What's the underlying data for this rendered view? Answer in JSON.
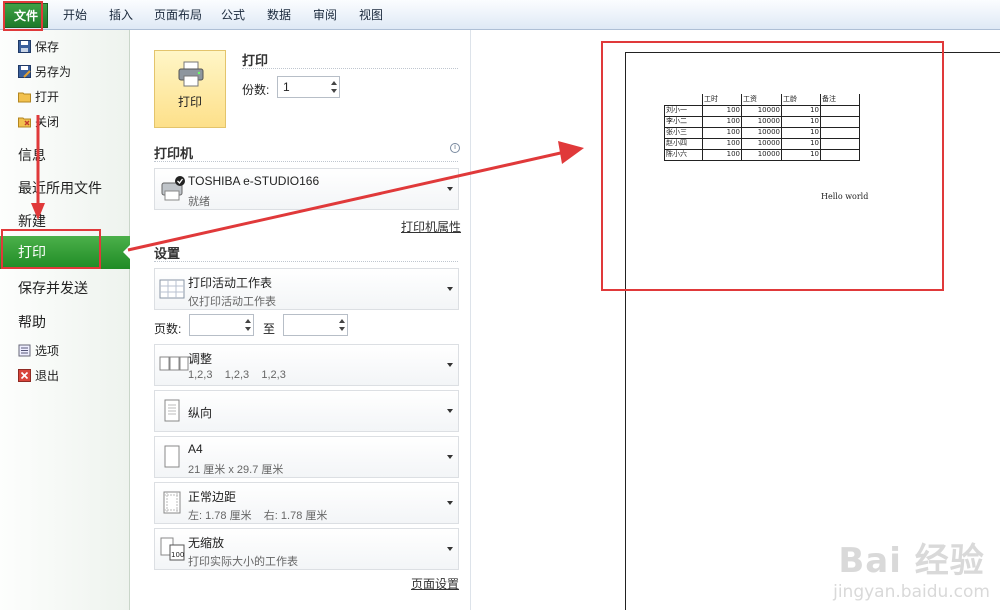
{
  "ribbon": {
    "tabs": [
      "文件",
      "开始",
      "插入",
      "页面布局",
      "公式",
      "数据",
      "审阅",
      "视图"
    ]
  },
  "nav": {
    "save": "保存",
    "save_as": "另存为",
    "open": "打开",
    "close": "关闭",
    "info": "信息",
    "recent": "最近所用文件",
    "new": "新建",
    "print": "打印",
    "save_send": "保存并发送",
    "help": "帮助",
    "options": "选项",
    "exit": "退出"
  },
  "print_panel": {
    "title": "打印",
    "button_label": "打印",
    "copies_label": "份数:",
    "copies_value": "1",
    "printer_section": "打印机",
    "printer_name": "TOSHIBA e-STUDIO166",
    "printer_status": "就绪",
    "printer_properties": "打印机属性",
    "settings_section": "设置",
    "scope_main": "打印活动工作表",
    "scope_sub": "仅打印活动工作表",
    "pages_label": "页数:",
    "pages_to": "至",
    "collate_main": "调整",
    "collate_sub": "1,2,3    1,2,3    1,2,3",
    "orientation": "纵向",
    "paper_main": "A4",
    "paper_sub": "21 厘米 x 29.7 厘米",
    "margins_main": "正常边距",
    "margins_sub": "左: 1.78 厘米    右: 1.78 厘米",
    "scale_main": "无缩放",
    "scale_sub": "打印实际大小的工作表",
    "page_setup": "页面设置"
  },
  "preview": {
    "headers": [
      "",
      "工时",
      "工资",
      "工龄",
      "备注"
    ],
    "rows": [
      [
        "刘小一",
        "100",
        "10000",
        "10",
        ""
      ],
      [
        "李小二",
        "100",
        "10000",
        "10",
        ""
      ],
      [
        "张小三",
        "100",
        "10000",
        "10",
        ""
      ],
      [
        "赵小四",
        "100",
        "10000",
        "10",
        ""
      ],
      [
        "陈小六",
        "100",
        "10000",
        "10",
        ""
      ]
    ],
    "hello": "Hello world"
  },
  "watermark": {
    "brand": "Bai 经验",
    "url": "jingyan.baidu.com"
  },
  "colors": {
    "accent_green": "#1f8b25",
    "annotation_red": "#e0393a"
  }
}
